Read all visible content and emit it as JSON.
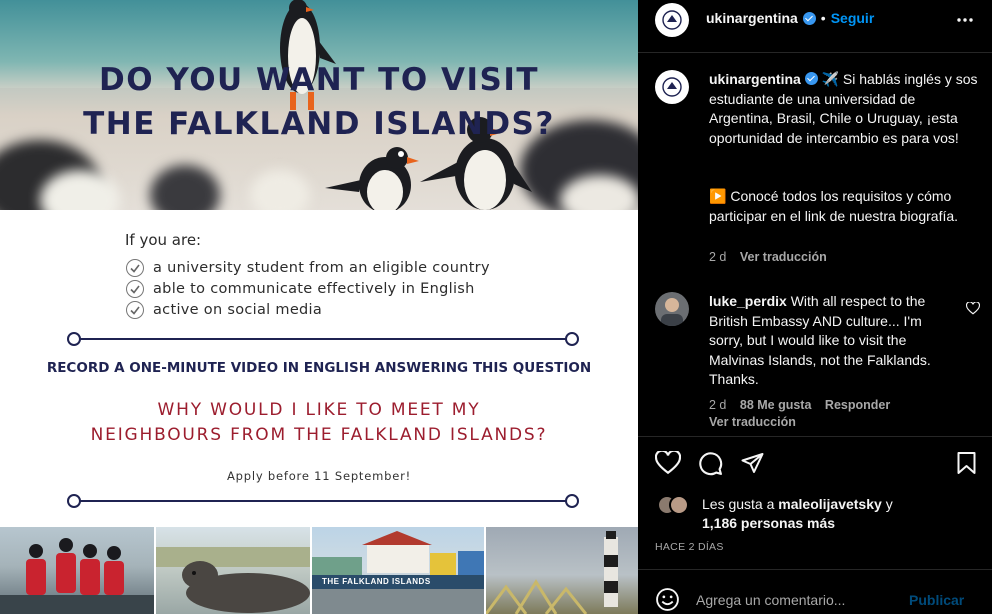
{
  "post": {
    "hero_title_line1": "DO YOU WANT TO VISIT",
    "hero_title_line2": "THE FALKLAND ISLANDS?",
    "intro": "If you are:",
    "requirements": [
      "a university student from an eligible country",
      "able to communicate effectively in English",
      "active on social media"
    ],
    "record_instruction": "RECORD A ONE-MINUTE VIDEO IN ENGLISH ANSWERING THIS QUESTION",
    "question_line1": "WHY WOULD I LIKE TO MEET MY",
    "question_line2": "NEIGHBOURS FROM THE FALKLAND ISLANDS?",
    "apply": "Apply before 11 September!",
    "building_sign": "THE FALKLAND ISLANDS"
  },
  "header": {
    "username": "ukinargentina",
    "separator": "•",
    "follow_label": "Seguir",
    "more_icon": "ellipsis-icon"
  },
  "caption": {
    "username": "ukinargentina",
    "emoji": "✈️",
    "text_p1": "Si hablás inglés y sos estudiante de una universidad de Argentina, Brasil, Chile o Uruguay, ¡esta oportunidad de intercambio es para vos!",
    "emoji2": "▶️",
    "text_p2": "Conocé todos los requisitos y cómo participar en el link de nuestra biografía.",
    "age": "2 d",
    "translate": "Ver traducción"
  },
  "comment": {
    "username": "luke_perdix",
    "text": "With all respect to the British Embassy AND culture... I'm sorry, but I would like to visit the Malvinas Islands, not the Falklands. Thanks.",
    "age": "2 d",
    "likes": "88 Me gusta",
    "reply": "Responder",
    "translate": "Ver traducción"
  },
  "actions": {
    "like_icon": "heart-icon",
    "comment_icon": "comment-icon",
    "share_icon": "send-icon",
    "save_icon": "bookmark-icon"
  },
  "likes": {
    "prefix": "Les gusta a",
    "user": "maleolijavetsky",
    "conj": "y",
    "others": "1,186 personas más"
  },
  "timestamp": "HACE 2 DÍAS",
  "add_comment": {
    "placeholder": "Agrega un comentario...",
    "publish": "Publicar"
  },
  "colors": {
    "accent": "#0095f6",
    "title_navy": "#1f2352",
    "question_red": "#9c1d2e"
  }
}
